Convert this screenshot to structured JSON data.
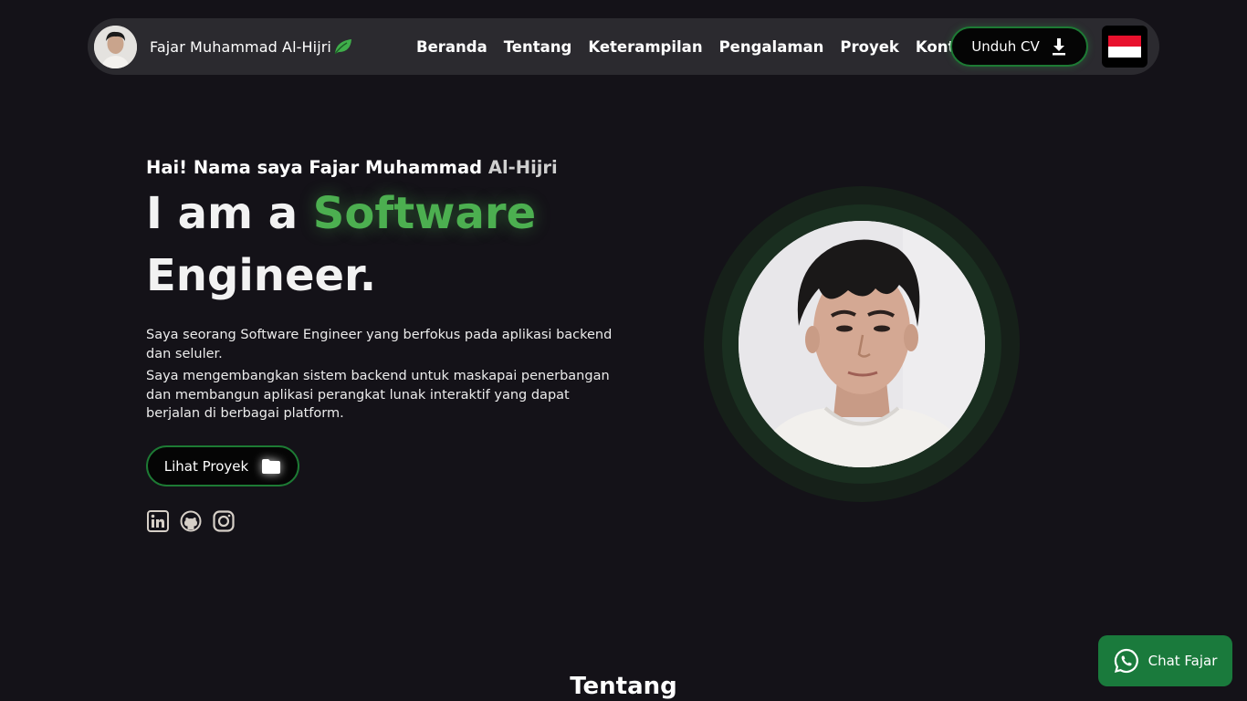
{
  "nav": {
    "brand_name": "Fajar Muhammad Al-Hijri",
    "links": [
      "Beranda",
      "Tentang",
      "Keterampilan",
      "Pengalaman",
      "Proyek",
      "Kontak"
    ],
    "cv_label": "Unduh CV",
    "language_flag": "indonesia-flag-icon"
  },
  "hero": {
    "greeting_main": "Hai! Nama saya Fajar Muhammad ",
    "greeting_dim": "Al-Hijri",
    "title_prefix": "I am a ",
    "title_accent": "Software",
    "title_line2": "Engineer.",
    "desc_1": "Saya seorang Software Engineer yang berfokus pada aplikasi backend dan seluler.",
    "desc_2": "Saya mengembangkan sistem backend untuk maskapai penerbangan dan membangun aplikasi perangkat lunak interaktif yang dapat berjalan di berbagai platform.",
    "project_button": "Lihat Proyek",
    "socials": [
      "linkedin-icon",
      "github-icon",
      "instagram-icon"
    ]
  },
  "section": {
    "about_title": "Tentang"
  },
  "chat": {
    "label": "Chat Fajar"
  },
  "colors": {
    "background": "#141218",
    "navbar": "#2b2a2f",
    "accent_green": "#4caf50",
    "button_border": "#1d7a34",
    "whatsapp_green": "#1a7a3c",
    "flag_red": "#e8112d",
    "flag_white": "#ffffff"
  }
}
